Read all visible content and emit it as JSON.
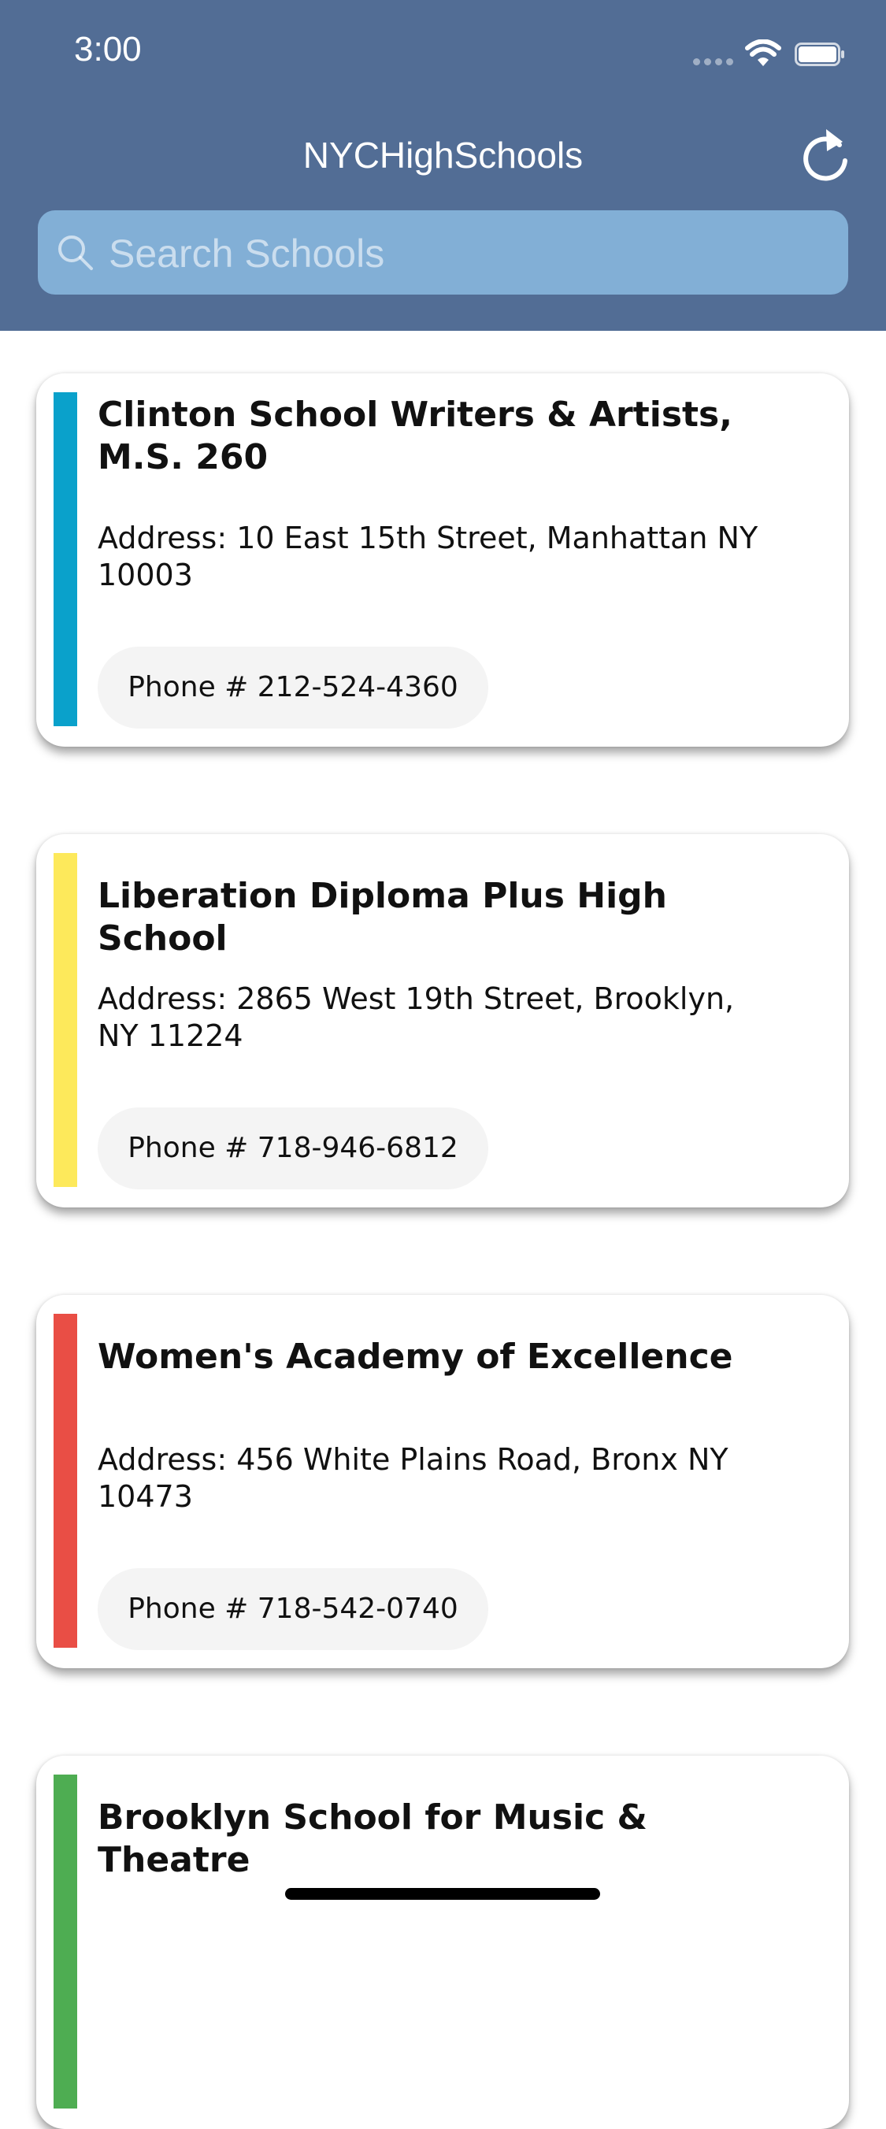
{
  "status_bar": {
    "time": "3:00"
  },
  "nav": {
    "title": "NYCHighSchools",
    "refresh_icon": "refresh-icon"
  },
  "search": {
    "placeholder": "Search Schools",
    "value": "",
    "icon": "search-icon"
  },
  "colors": {
    "header_bg": "#526d95",
    "search_bg": "#82afd6",
    "phone_pill_bg": "#f4f4f4"
  },
  "schools": [
    {
      "name": "Clinton School Writers & Artists, M.S. 260",
      "address": "Address: 10 East 15th Street, Manhattan NY 10003",
      "phone": "Phone # 212-524-4360",
      "accent": "#0aa1cb"
    },
    {
      "name": "Liberation Diploma Plus High School",
      "address": "Address: 2865 West 19th Street, Brooklyn, NY 11224",
      "phone": "Phone # 718-946-6812",
      "accent": "#fde95b"
    },
    {
      "name": "Women's Academy of Excellence",
      "address": "Address: 456 White Plains Road, Bronx NY 10473",
      "phone": "Phone # 718-542-0740",
      "accent": "#e94e45"
    },
    {
      "name": "Brooklyn School for Music & Theatre",
      "address": "",
      "phone": "",
      "accent": "#4ead52"
    }
  ]
}
